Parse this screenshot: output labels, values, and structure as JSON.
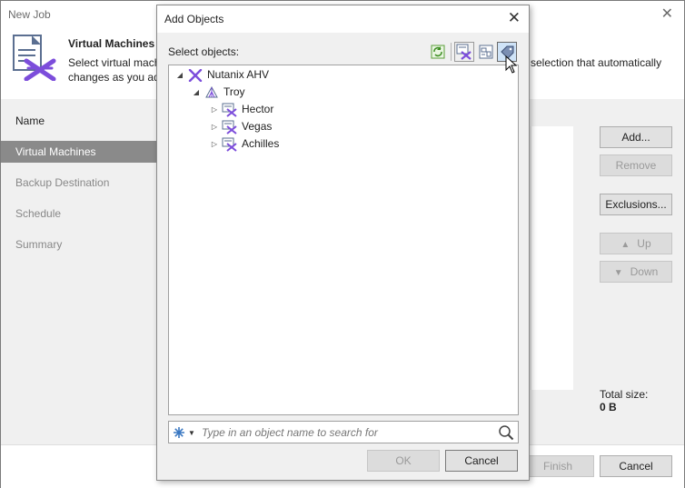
{
  "window": {
    "title": "New Job",
    "close_glyph": "✕"
  },
  "header": {
    "title": "Virtual Machines",
    "desc_line1_left": "Select virtual mach",
    "desc_line1_right": "selection that automatically",
    "desc_line2_left": "changes as you ad",
    "icon": "nutanix-job-icon"
  },
  "sidebar": {
    "steps": [
      {
        "label": "Name",
        "state": "done"
      },
      {
        "label": "Virtual Machines",
        "state": "active"
      },
      {
        "label": "Backup Destination",
        "state": "pending"
      },
      {
        "label": "Schedule",
        "state": "pending"
      },
      {
        "label": "Summary",
        "state": "pending"
      }
    ]
  },
  "right_buttons": {
    "add": "Add...",
    "remove": "Remove",
    "exclusions": "Exclusions...",
    "up": "Up",
    "down": "Down"
  },
  "total_size": {
    "label": "Total size:",
    "value": "0 B"
  },
  "footer": {
    "finish": "Finish",
    "cancel": "Cancel"
  },
  "dialog": {
    "title": "Add Objects",
    "close_glyph": "✕",
    "select_label": "Select objects:",
    "toolbar": [
      {
        "icon": "refresh-icon",
        "active": false
      },
      {
        "icon": "vms-and-groups-view-icon",
        "active": false
      },
      {
        "icon": "hosts-view-icon",
        "active": false
      },
      {
        "icon": "tags-view-icon",
        "active": true
      }
    ],
    "tree": {
      "root": {
        "label": "Nutanix AHV",
        "icon": "nutanix-icon",
        "expanded": true
      },
      "cluster": {
        "label": "Troy",
        "icon": "cluster-icon",
        "expanded": true
      },
      "hosts": [
        {
          "label": "Hector",
          "icon": "host-icon",
          "expanded": false
        },
        {
          "label": "Vegas",
          "icon": "host-icon",
          "expanded": false
        },
        {
          "label": "Achilles",
          "icon": "host-icon",
          "expanded": false
        }
      ]
    },
    "search": {
      "placeholder": "Type in an object name to search for",
      "value": ""
    },
    "buttons": {
      "ok": "OK",
      "cancel": "Cancel"
    }
  },
  "colors": {
    "nutanix_purple": "#7c4ddb",
    "active_step_bg": "#8a8a8a",
    "toolbar_active_bg": "#cfe3f7"
  }
}
